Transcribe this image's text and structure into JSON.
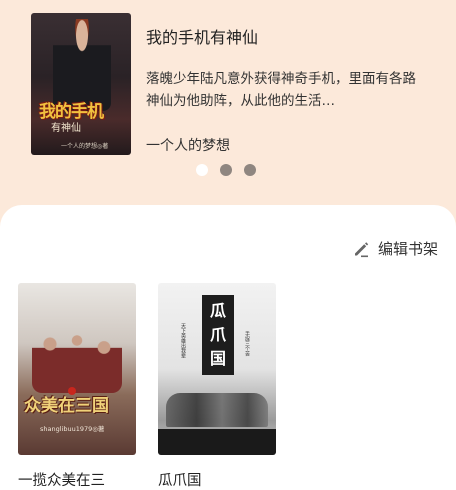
{
  "featured": {
    "title": "我的手机有神仙",
    "description": "落魄少年陆凡意外获得神奇手机，里面有各路神仙为他助阵，从此他的生活…",
    "author": "一个人的梦想",
    "cover": {
      "title": "我的手机",
      "subtitle": "有神仙",
      "author": "一个人的梦想◎著"
    },
    "carousel": {
      "count": 3,
      "active_index": 0
    }
  },
  "shelf": {
    "edit_label": "编辑书架",
    "books": [
      {
        "name": "一揽众美在三",
        "cover": {
          "title": "众美在三国",
          "author": "shanglibuu1979◎著"
        }
      },
      {
        "name": "瓜爪国",
        "cover": {
          "title_chars": [
            "瓜",
            "爪",
            "国"
          ],
          "side_left": "天下英雄出我辈",
          "side_right": "手捉三个苦"
        }
      }
    ]
  },
  "colors": {
    "top_bg": "#fce9da",
    "shelf_bg": "#ffffff",
    "dot_inactive": "#8f8680",
    "dot_active": "#ffffff"
  }
}
